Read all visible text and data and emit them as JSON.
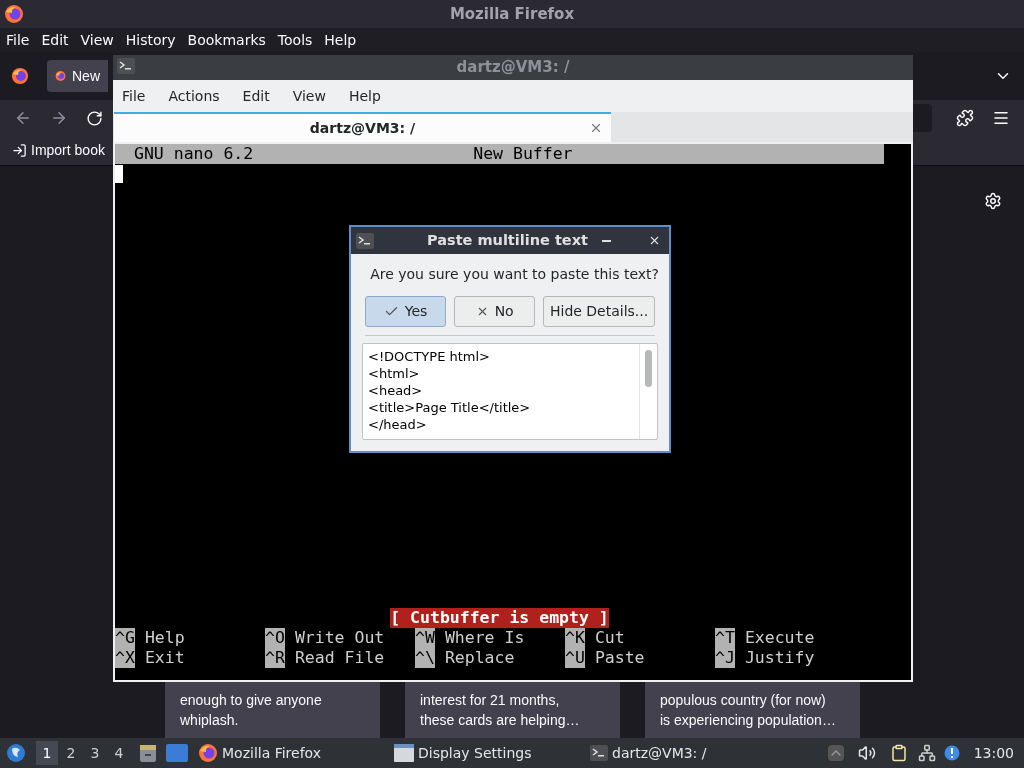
{
  "firefox": {
    "title": "Mozilla Firefox",
    "menu": [
      "File",
      "Edit",
      "View",
      "History",
      "Bookmarks",
      "Tools",
      "Help"
    ],
    "tab": {
      "label": "New"
    },
    "bookmark": "Import book",
    "cards": [
      {
        "lines": [
          "enough to give anyone",
          "whiplash."
        ]
      },
      {
        "lines": [
          "interest for 21 months,",
          "these cards are helping…"
        ]
      },
      {
        "lines": [
          "populous country (for now)",
          "is experiencing population…"
        ]
      }
    ]
  },
  "terminal": {
    "title": "dartz@VM3: /",
    "menu": [
      "File",
      "Actions",
      "Edit",
      "View",
      "Help"
    ],
    "tab": {
      "label": "dartz@VM3: /"
    },
    "nano": {
      "version": "GNU nano 6.2",
      "buffer": "New Buffer",
      "status": "[ Cutbuffer is empty ]",
      "shortcut_rows": [
        [
          {
            "key": "^G",
            "label": "Help"
          },
          {
            "key": "^O",
            "label": "Write Out"
          },
          {
            "key": "^W",
            "label": "Where Is"
          },
          {
            "key": "^K",
            "label": "Cut"
          },
          {
            "key": "^T",
            "label": "Execute"
          }
        ],
        [
          {
            "key": "^X",
            "label": "Exit"
          },
          {
            "key": "^R",
            "label": "Read File"
          },
          {
            "key": "^\\",
            "label": "Replace"
          },
          {
            "key": "^U",
            "label": "Paste"
          },
          {
            "key": "^J",
            "label": "Justify"
          }
        ]
      ]
    }
  },
  "dialog": {
    "title": "Paste multiline text",
    "question": "Are you sure you want to paste this text?",
    "buttons": [
      {
        "label": "Yes",
        "kind": "yes",
        "selected": true
      },
      {
        "label": "No",
        "kind": "no",
        "selected": false
      },
      {
        "label": "Hide Details...",
        "kind": "plain",
        "selected": false
      }
    ],
    "preview": [
      "<!DOCTYPE html>",
      "<html>",
      "<head>",
      "<title>Page Title</title>",
      "</head>"
    ]
  },
  "taskbar": {
    "workspaces": [
      {
        "label": "1",
        "selected": true
      },
      {
        "label": "2",
        "selected": false
      },
      {
        "label": "3",
        "selected": false
      },
      {
        "label": "4",
        "selected": false
      }
    ],
    "tasks": [
      {
        "label": "Mozilla Firefox",
        "kind": "firefox"
      },
      {
        "label": "Display Settings",
        "kind": "window"
      },
      {
        "label": "dartz@VM3: /",
        "kind": "terminal"
      }
    ],
    "clock": "13:00"
  }
}
